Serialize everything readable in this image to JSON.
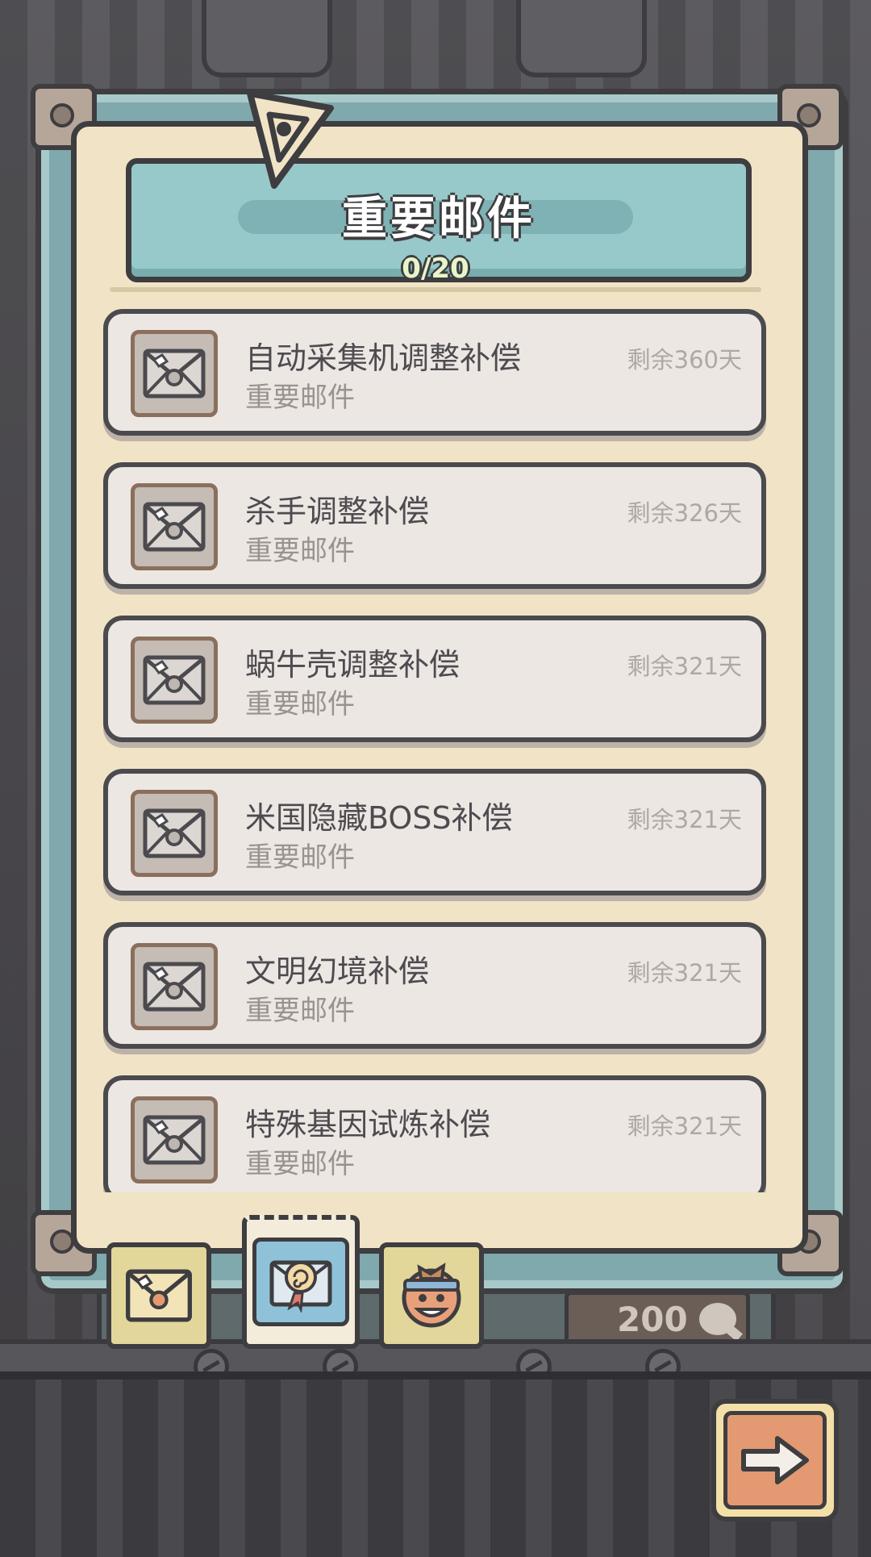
{
  "header": {
    "title": "重要邮件",
    "counter": "0/20"
  },
  "mails": [
    {
      "title": "自动采集机调整补偿",
      "subtitle": "重要邮件",
      "remaining": "剩余360天"
    },
    {
      "title": "杀手调整补偿",
      "subtitle": "重要邮件",
      "remaining": "剩余326天"
    },
    {
      "title": "蜗牛壳调整补偿",
      "subtitle": "重要邮件",
      "remaining": "剩余321天"
    },
    {
      "title": "米国隐藏BOSS补偿",
      "subtitle": "重要邮件",
      "remaining": "剩余321天"
    },
    {
      "title": "文明幻境补偿",
      "subtitle": "重要邮件",
      "remaining": "剩余321天"
    },
    {
      "title": "特殊基因试炼补偿",
      "subtitle": "重要邮件",
      "remaining": "剩余321天"
    }
  ],
  "tabs": [
    {
      "icon": "envelope-icon",
      "active": false
    },
    {
      "icon": "snail-shell-ribbon-icon",
      "active": true
    },
    {
      "icon": "character-face-icon",
      "active": false
    }
  ],
  "background": {
    "counter_value": "200",
    "counter_icon": "chat-bubble-icon"
  },
  "controls": {
    "next_icon": "right-arrow-icon"
  },
  "colors": {
    "frame_teal": "#7fa9ad",
    "paper": "#f1e4c6",
    "banner": "#98c9ca",
    "item_bg": "#ece7e3",
    "outline": "#3e3d40",
    "counter_green": "#e8f5c8",
    "next_orange": "#e39a72"
  }
}
